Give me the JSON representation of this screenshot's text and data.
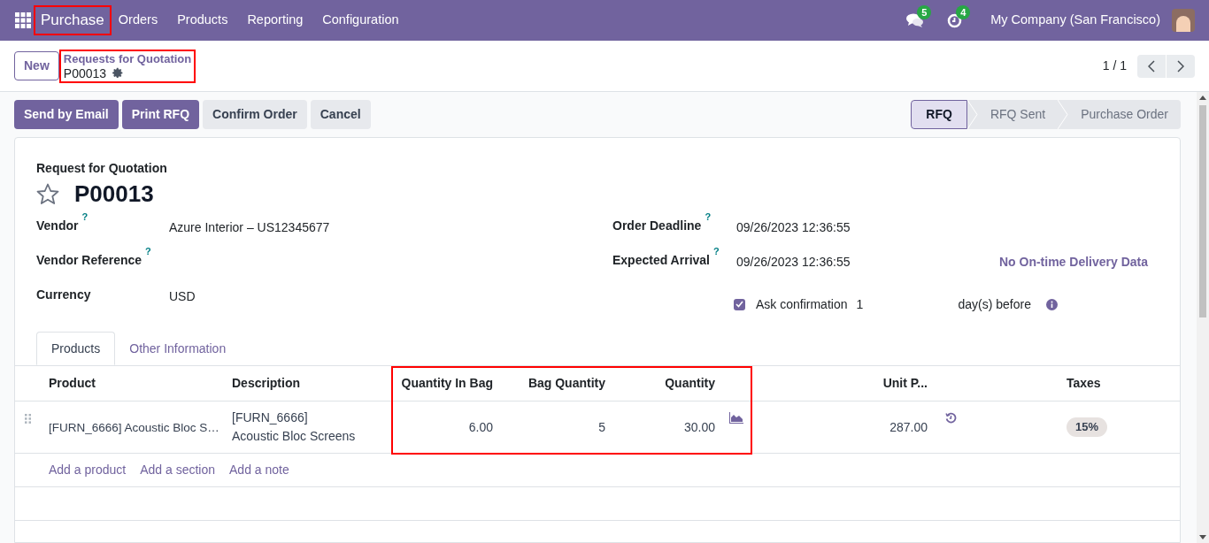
{
  "navbar": {
    "app": "Purchase",
    "app_highlighted": true,
    "menu": [
      "Orders",
      "Products",
      "Reporting",
      "Configuration"
    ],
    "messages_count": "5",
    "activities_count": "4",
    "company": "My Company (San Francisco)"
  },
  "control_panel": {
    "new_button": "New",
    "breadcrumb": "Requests for Quotation",
    "record": "P00013",
    "highlighted": true,
    "pager": "1 / 1"
  },
  "action_buttons": [
    {
      "label": "Send by Email",
      "primary": true
    },
    {
      "label": "Print RFQ",
      "primary": true
    },
    {
      "label": "Confirm Order",
      "primary": false
    },
    {
      "label": "Cancel",
      "primary": false
    }
  ],
  "status_bar": [
    {
      "label": "RFQ",
      "selected": true
    },
    {
      "label": "RFQ Sent",
      "selected": false
    },
    {
      "label": "Purchase Order",
      "selected": false
    }
  ],
  "form": {
    "subtitle": "Request for Quotation",
    "title": "P00013",
    "starred": false,
    "left_fields": [
      {
        "label": "Vendor",
        "help": "?",
        "value": "Azure Interior – US12345677"
      },
      {
        "label": "Vendor Reference",
        "help": "?"
      },
      {
        "label": "Currency",
        "value": "USD"
      }
    ],
    "right_fields": [
      {
        "label": "Order Deadline",
        "help": "?",
        "value": "09/26/2023 12:36:55"
      },
      {
        "label": "Expected Arrival",
        "help": "?",
        "value": "09/26/2023 12:36:55",
        "extra": "No On-time Delivery Data"
      }
    ],
    "ask_confirmation": {
      "checked": true,
      "label": "Ask confirmation",
      "value": "1",
      "suffix": "day(s) before"
    }
  },
  "tabs": [
    {
      "label": "Products",
      "selected": true
    },
    {
      "label": "Other Information",
      "selected": false
    }
  ],
  "table": {
    "columns": [
      {
        "label": "Product",
        "kind": "text",
        "highlighted": false
      },
      {
        "label": "Description",
        "kind": "text",
        "highlighted": false
      },
      {
        "label": "Quantity In Bag",
        "kind": "number",
        "highlighted": true
      },
      {
        "label": "Bag Quantity",
        "kind": "number",
        "highlighted": true
      },
      {
        "label": "Quantity",
        "kind": "number",
        "highlighted": true
      },
      {
        "label": "Unit P...",
        "kind": "number",
        "highlighted": false
      },
      {
        "label": "Taxes",
        "kind": "tag",
        "highlighted": false
      }
    ],
    "rows": [
      {
        "cells": [
          "[FURN_6666] Acoustic Bloc S…",
          "[FURN_6666]\nAcoustic Bloc Screens",
          "6.00",
          "5",
          "30.00",
          "287.00",
          "15%"
        ]
      }
    ],
    "add_links": [
      "Add a product",
      "Add a section",
      "Add a note"
    ]
  }
}
